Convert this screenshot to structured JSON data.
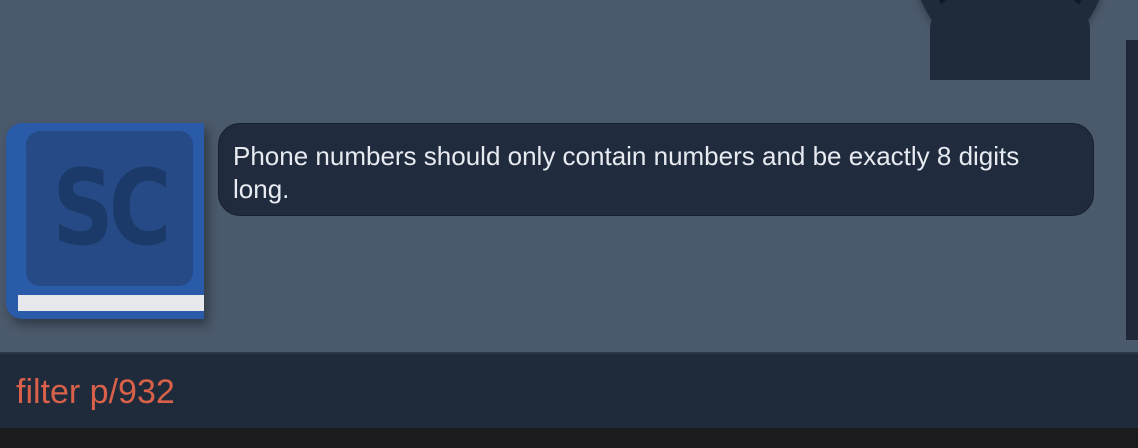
{
  "chat": {
    "messages": [
      {
        "sender": "bot",
        "avatar_icon": "sc-book-logo-icon",
        "avatar_text": "SC",
        "text": "Phone numbers should only contain numbers and be exactly 8 digits long."
      }
    ],
    "user_avatar_icon": "user-avatar-icon"
  },
  "command_box": {
    "value": "filter p/932",
    "text_color": "#d9614a"
  },
  "colors": {
    "chat_background": "#4a596b",
    "bubble_background": "#202b3d",
    "command_background": "#1f2a3b",
    "bot_avatar": "#2a5ba8"
  }
}
